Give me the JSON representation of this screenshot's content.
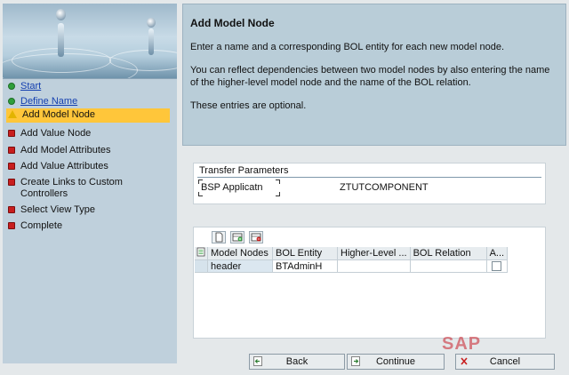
{
  "wizard": {
    "steps": [
      {
        "label": "Start",
        "state": "done",
        "link": true
      },
      {
        "label": "Define Name",
        "state": "done",
        "link": true
      },
      {
        "label": "Add Model Node",
        "state": "current",
        "link": false
      },
      {
        "label": "Add Value Node",
        "state": "todo",
        "link": false
      },
      {
        "label": "Add Model Attributes",
        "state": "todo",
        "link": false
      },
      {
        "label": "Add Value Attributes",
        "state": "todo",
        "link": false
      },
      {
        "label": "Create Links to Custom Controllers",
        "state": "todo",
        "link": false
      },
      {
        "label": "Select View Type",
        "state": "todo",
        "link": false
      },
      {
        "label": "Complete",
        "state": "todo",
        "link": false
      }
    ]
  },
  "info": {
    "title": "Add Model Node",
    "paragraphs": [
      "Enter a name and a corresponding BOL entity for each new model node.",
      "You can reflect dependencies between two model nodes by also entering the name of the higher-level model node and the name of the BOL relation.",
      "These entries are optional."
    ]
  },
  "transfer": {
    "title": "Transfer Parameters",
    "label": "BSP Applicatn",
    "value": "ZTUTCOMPONENT"
  },
  "table": {
    "columns": [
      "Model Nodes",
      "BOL Entity",
      "Higher-Level ...",
      "BOL Relation",
      "A..."
    ],
    "rows": [
      {
        "model_node": "header",
        "bol_entity": "BTAdminH",
        "higher_level": "",
        "bol_relation": "",
        "flag": false
      }
    ]
  },
  "buttons": {
    "back": "Back",
    "continue": "Continue",
    "cancel": "Cancel"
  },
  "watermark": "SAP",
  "colors": {
    "current_step": "#ffc63a",
    "done_icon": "#2e9f3a",
    "todo_icon": "#c81e1e",
    "warn_icon": "#e3b400",
    "info_panel": "#b9cdd8"
  }
}
